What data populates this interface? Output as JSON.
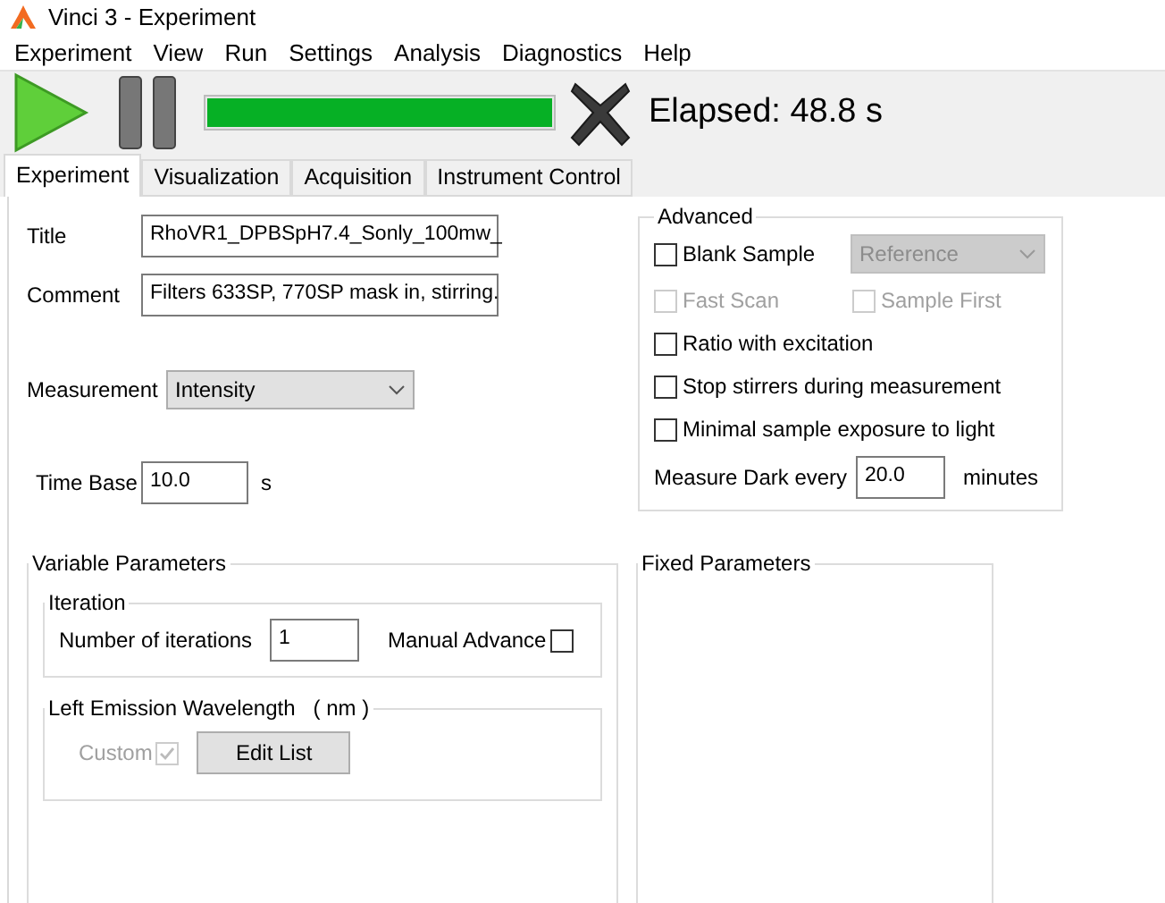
{
  "window": {
    "title": "Vinci 3 - Experiment"
  },
  "menu": [
    "Experiment",
    "View",
    "Run",
    "Settings",
    "Analysis",
    "Diagnostics",
    "Help"
  ],
  "toolbar": {
    "progress": {
      "level": 1.0
    },
    "elapsed": "Elapsed: 48.8 s"
  },
  "tabs": [
    {
      "label": "Experiment",
      "selected": true
    },
    {
      "label": "Visualization",
      "selected": false
    },
    {
      "label": "Acquisition",
      "selected": false
    },
    {
      "label": "Instrument Control",
      "selected": false
    }
  ],
  "form": {
    "title": {
      "label": "Title",
      "value": "RhoVR1_DPBSpH7.4_Sonly_100mw_"
    },
    "comment": {
      "label": "Comment",
      "value": "Filters 633SP, 770SP mask in, stirring."
    },
    "measurement": {
      "label": "Measurement",
      "value": "Intensity"
    },
    "time_base": {
      "label": "Time Base",
      "value": "10.0",
      "unit": "s"
    }
  },
  "advanced": {
    "title": "Advanced",
    "blank_sample": {
      "label": "Blank Sample",
      "checked": false,
      "disabled": false
    },
    "reference": {
      "value": "Reference",
      "disabled": true
    },
    "fast_scan": {
      "label": "Fast Scan",
      "checked": false,
      "disabled": true
    },
    "sample_first": {
      "label": "Sample First",
      "checked": false,
      "disabled": true
    },
    "options": [
      {
        "label": "Ratio with excitation",
        "checked": false,
        "disabled": false
      },
      {
        "label": "Stop stirrers during measurement",
        "checked": false,
        "disabled": false
      },
      {
        "label": "Minimal sample exposure to light",
        "checked": false,
        "disabled": false
      }
    ],
    "dark": {
      "label": "Measure Dark every",
      "value": "20.0",
      "unit": "minutes"
    }
  },
  "variable_parameters": {
    "title": "Variable Parameters",
    "iteration": {
      "title": "Iteration",
      "label": "Number of iterations",
      "value": "1",
      "manual_advance": {
        "label": "Manual Advance",
        "checked": false,
        "disabled": false
      }
    },
    "wavelength": {
      "title": "Left Emission Wavelength   ( nm )",
      "custom": {
        "label": "Custom",
        "checked": true,
        "disabled": true
      },
      "button": "Edit List"
    }
  },
  "fixed_parameters": {
    "title": "Fixed Parameters"
  }
}
